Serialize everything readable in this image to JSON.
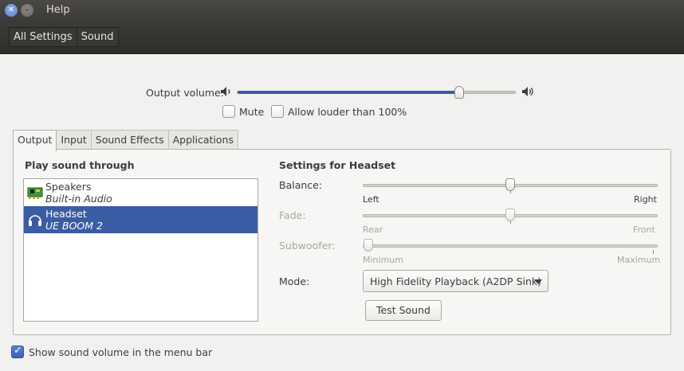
{
  "window": {
    "title": "Help"
  },
  "breadcrumbs": [
    "All Settings",
    "Sound"
  ],
  "output_volume": {
    "label": "Output volume:",
    "level": 0.8
  },
  "mute": {
    "label": "Mute",
    "checked": false
  },
  "allow_louder": {
    "label": "Allow louder than 100%",
    "checked": false
  },
  "tabs": [
    {
      "label": "Output",
      "active": true
    },
    {
      "label": "Input",
      "active": false
    },
    {
      "label": "Sound Effects",
      "active": false
    },
    {
      "label": "Applications",
      "active": false
    }
  ],
  "devices": {
    "heading": "Play sound through",
    "items": [
      {
        "name": "Speakers",
        "sub": "Built-in Audio",
        "icon": "sound-card-icon",
        "selected": false
      },
      {
        "name": "Headset",
        "sub": "UE BOOM 2",
        "icon": "headphones-icon",
        "selected": true
      }
    ]
  },
  "settings": {
    "heading": "Settings for Headset",
    "balance": {
      "label": "Balance:",
      "left": "Left",
      "right": "Right",
      "value": 0.5,
      "enabled": true
    },
    "fade": {
      "label": "Fade:",
      "left": "Rear",
      "right": "Front",
      "value": 0.5,
      "enabled": false
    },
    "subwoofer": {
      "label": "Subwoofer:",
      "left": "Minimum",
      "right": "Maximum",
      "value": 0.0,
      "enabled": false
    },
    "mode": {
      "label": "Mode:",
      "value": "High Fidelity Playback (A2DP Sink)"
    },
    "test_button": "Test Sound"
  },
  "menubar_option": {
    "label": "Show sound volume in the menu bar",
    "checked": true
  },
  "colors": {
    "accent": "#3a5ca5",
    "titlebar": "#3c3b37"
  }
}
